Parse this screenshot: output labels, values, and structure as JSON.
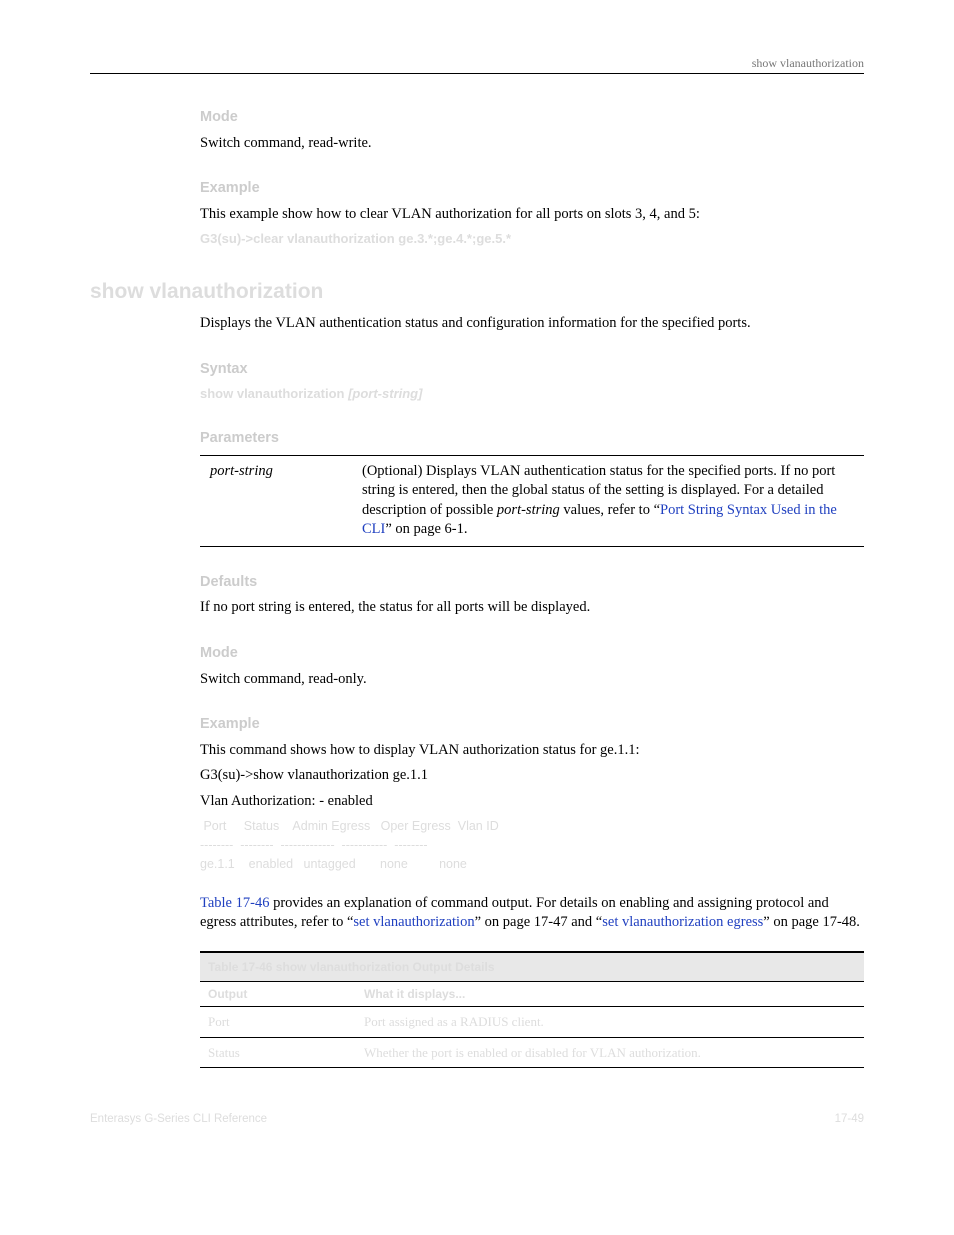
{
  "header": {
    "running": "show vlanauthorization"
  },
  "s1": {
    "mode_h": "Mode",
    "mode_txt": "Switch command, read-write.",
    "ex_h": "Example",
    "ex_txt": "This example show how to clear VLAN authorization for all ports on slots 3, 4, and 5:",
    "ex_code": "G3(su)->clear vlanauthorization ge.3.*;ge.4.*;ge.5.*"
  },
  "cmd": {
    "title": "show vlanauthorization",
    "desc": "Displays the VLAN authentication status and configuration information for the specified ports.",
    "syntax_h": "Syntax",
    "syntax1": "show vlanauthorization ",
    "syntax2": "[port-string]",
    "params_h": "Parameters",
    "param_name": "port-string",
    "param_d1": "(Optional) Displays VLAN authentication status for the specified ports. If no port string is entered, then the global status of the setting is displayed. For a detailed description of possible ",
    "param_em": "port-string",
    "param_d2": " values, refer to “",
    "param_link": "Port String Syntax Used in the CLI",
    "param_d3": "” on page 6-1.",
    "def_h": "Defaults",
    "def_txt": "If no port string is entered, the status for all ports will be displayed.",
    "mode_h": "Mode",
    "mode_txt": "Switch command, read-only.",
    "ex_h": "Example",
    "ex_txt": "This command shows how to display VLAN authorization status for ge.1.1:",
    "ex_l1": "G3(su)->show vlanauthorization ge.1.1",
    "ex_l2": "Vlan Authorization:  - enabled",
    "ex_block": " Port     Status    Admin Egress   Oper Egress  Vlan ID \n--------  --------  -------------  -----------  -------- \nge.1.1    enabled   untagged       none         none                ",
    "note_a": " provides an explanation of command output. For details on enabling and assigning protocol and egress attributes, refer to “",
    "note_link1": "Table 17-46",
    "note_link2": "set vlanauthorization",
    "note_b": "” on page 17-47 and “",
    "note_link3": "set vlanauthorization egress",
    "note_c": "” on page 17-48."
  },
  "tbl": {
    "caption": "Table 17-46  show vlanauthorization Output Details",
    "h1": "Output",
    "h2": "What it displays...",
    "r1c1": "Port",
    "r1c2": "Port assigned as a RADIUS client.",
    "r2c1": "Status",
    "r2c2": "Whether the port is enabled or disabled for VLAN authorization."
  },
  "footer": {
    "left": "Enterasys G-Series CLI Reference",
    "right": "17-49"
  }
}
